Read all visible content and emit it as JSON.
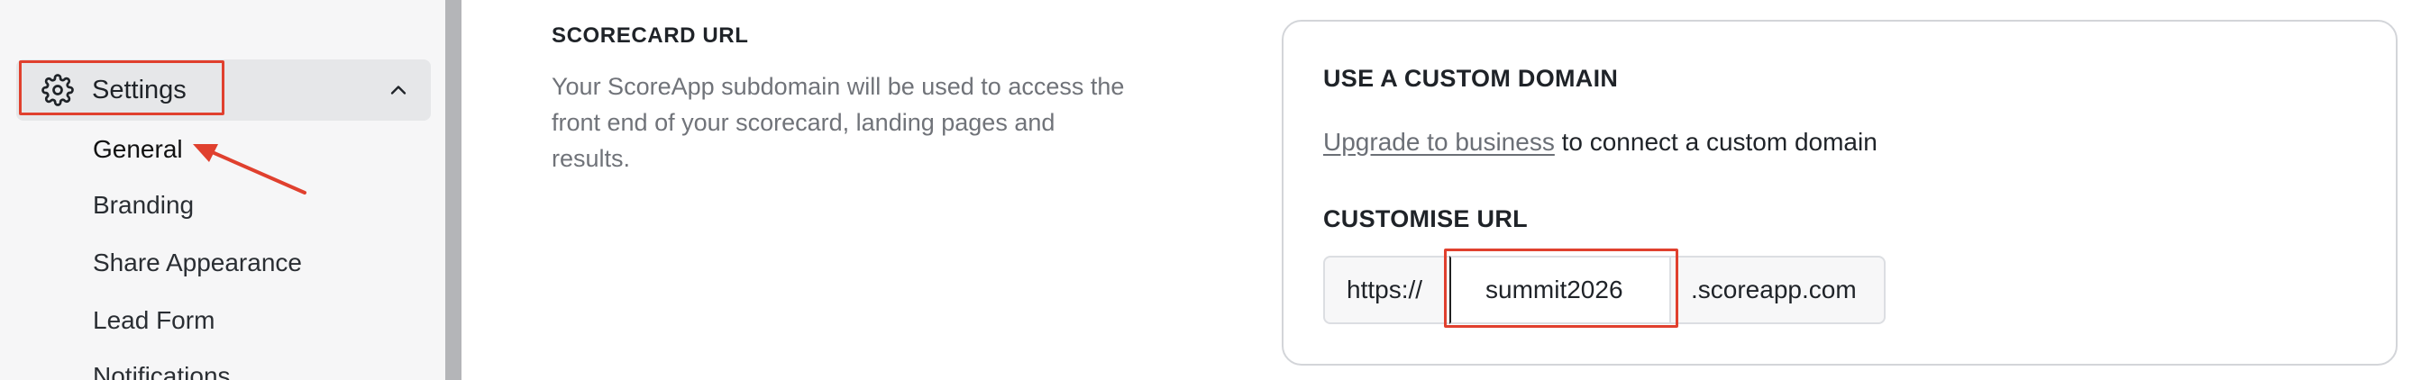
{
  "sidebar": {
    "settings_label": "Settings",
    "items": [
      {
        "label": "General"
      },
      {
        "label": "Branding"
      },
      {
        "label": "Share Appearance"
      },
      {
        "label": "Lead Form"
      },
      {
        "label": "Notifications"
      }
    ]
  },
  "main": {
    "section_title": "SCORECARD URL",
    "section_description": "Your ScoreApp subdomain will be used to access the front end of your scorecard, landing pages and results."
  },
  "card": {
    "custom_domain_heading": "USE A CUSTOM DOMAIN",
    "upgrade_link": "Upgrade to business",
    "upgrade_suffix": " to connect a custom domain",
    "customise_heading": "CUSTOMISE URL",
    "url_prefix": "https://",
    "subdomain_value": "summit2026",
    "url_suffix": ".scoreapp.com"
  },
  "colors": {
    "annotation": "#e0402e",
    "sidebar_bg": "#f6f6f7",
    "active_item_bg": "#e6e7e9"
  },
  "icons": {
    "settings": "gear-icon",
    "expand": "chevron-up-icon"
  }
}
